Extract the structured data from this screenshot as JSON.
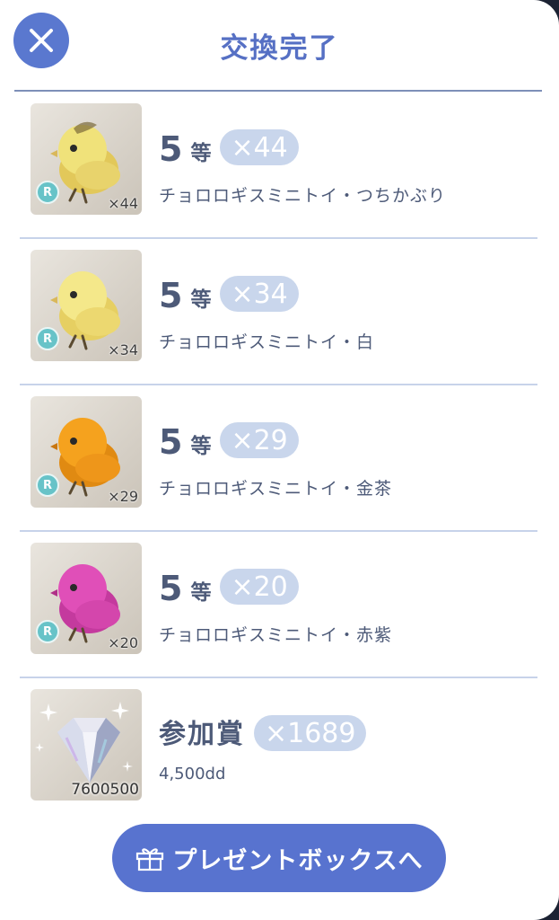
{
  "header": {
    "title": "交換完了",
    "close_icon": "close-icon"
  },
  "items": [
    {
      "rank_num": "5",
      "rank_unit": "等",
      "qty_pill": "×44",
      "name": "チョロロギスミニトイ・つちかぶり",
      "rarity": "R",
      "thumb_count": "×44",
      "bird_color": "#f0e27a",
      "bird_shade": "#e2c85a",
      "icon": "yellow-bird-toy-icon"
    },
    {
      "rank_num": "5",
      "rank_unit": "等",
      "qty_pill": "×34",
      "name": "チョロロギスミニトイ・白",
      "rarity": "R",
      "thumb_count": "×34",
      "bird_color": "#f4e88a",
      "bird_shade": "#e6cf62",
      "icon": "yellow-bird-toy-icon"
    },
    {
      "rank_num": "5",
      "rank_unit": "等",
      "qty_pill": "×29",
      "name": "チョロロギスミニトイ・金茶",
      "rarity": "R",
      "thumb_count": "×29",
      "bird_color": "#f5a21e",
      "bird_shade": "#e08a12",
      "icon": "orange-bird-toy-icon"
    },
    {
      "rank_num": "5",
      "rank_unit": "等",
      "qty_pill": "×20",
      "name": "チョロロギスミニトイ・赤紫",
      "rarity": "R",
      "thumb_count": "×20",
      "bird_color": "#e04fb8",
      "bird_shade": "#c43a9e",
      "icon": "magenta-bird-toy-icon"
    }
  ],
  "participation": {
    "title": "参加賞",
    "qty_pill": "×1689",
    "sub": "4,500dd",
    "thumb_count": "7600500",
    "icon": "diamond-icon"
  },
  "present_button": {
    "label": "プレゼントボックスへ",
    "icon": "gift-box-icon"
  },
  "colors": {
    "accent": "#5873cf",
    "pill": "#c9d6ec",
    "text": "#4d5a78",
    "rarity_badge": "#67c3c8"
  }
}
